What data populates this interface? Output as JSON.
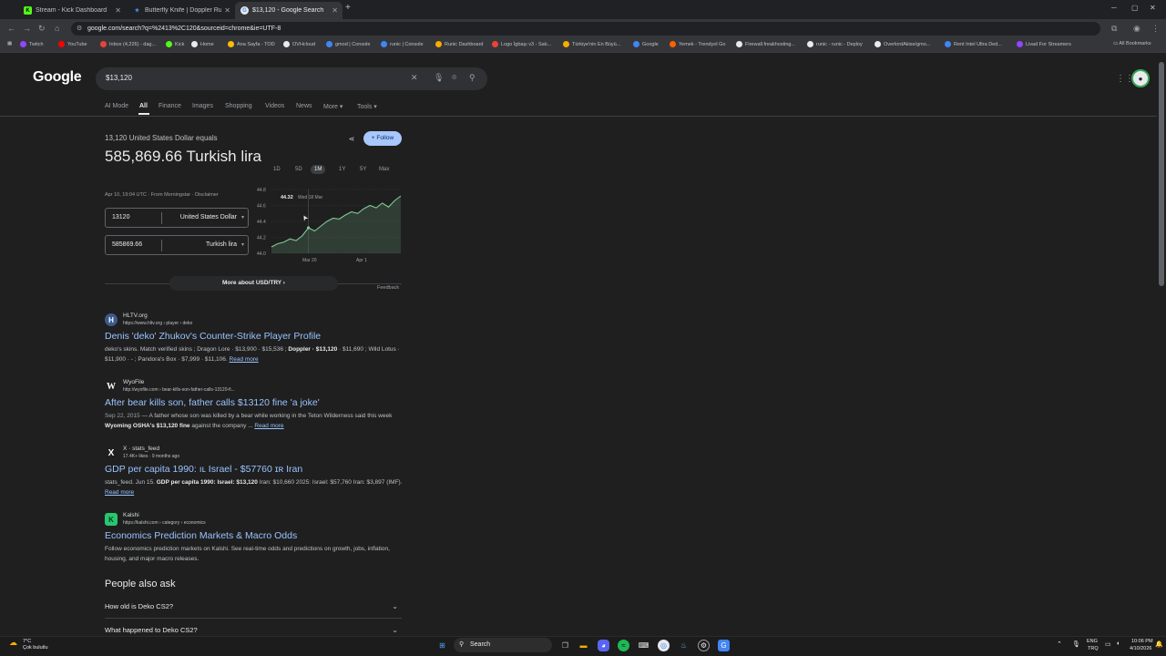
{
  "browser": {
    "tabs": [
      {
        "label": "Stream - Kick Dashboard",
        "fav": "K",
        "fav_color": "#53fc18"
      },
      {
        "label": "Butterfly Knife | Doppler Rub",
        "fav": "★",
        "fav_color": "#4a90e2"
      },
      {
        "label": "$13,120 - Google Search",
        "fav": "G",
        "fav_color": "#4285f4"
      }
    ],
    "new_tab": "+",
    "url": "google.com/search?q=%2413%2C120&sourceid=chrome&ie=UTF-8",
    "bookmarks": [
      "Twitch",
      "YouTube",
      "Inbox (4,226) - dag...",
      "Kick",
      "Home",
      "Ana Sayfa - TOD",
      "OVHcloud",
      "gmod | Console",
      "runic | Console",
      "Runic Dashboard",
      "Logo İgbaşı v3 - Satı...",
      "Türkiye'nin En Büyü...",
      "Google",
      "Yemek - Trendyol Go",
      "Firewall.freakhosting...",
      "runic - runic - Deploy",
      "OverlordAkise/gmo...",
      "Rent Intel Ultra Ded...",
      "Livad For Streamers"
    ],
    "all_bookmarks": "All Bookmarks"
  },
  "google": {
    "logo": "Google",
    "query": "$13,120",
    "tabs": [
      "AI Mode",
      "All",
      "Finance",
      "Images",
      "Shopping",
      "Videos",
      "News",
      "More ▾",
      "Tools ▾"
    ]
  },
  "converter": {
    "subtitle": "13,120 United States Dollar equals",
    "result": "585,869.66 Turkish lira",
    "meta": "Apr 10, 19:04 UTC · From Morningstar · Disclaimer",
    "from_amount": "13120",
    "from_currency": "United States Dollar",
    "to_amount": "585869.66",
    "to_currency": "Turkish lira",
    "follow": "+ Follow",
    "ranges": [
      "1D",
      "5D",
      "1M",
      "1Y",
      "5Y",
      "Max"
    ],
    "active_range": "1M",
    "more_about": "More about USD/TRY  ›",
    "feedback": "Feedback"
  },
  "chart_data": {
    "type": "area",
    "y_ticks": [
      "44.8",
      "44.6",
      "44.4",
      "44.2",
      "44.0"
    ],
    "ylim": [
      44.0,
      44.8
    ],
    "x_ticks": [
      "Mar 20",
      "Apr 1"
    ],
    "tooltip_value": "44.32",
    "tooltip_date": "Wed 18 Mar",
    "values": [
      44.08,
      44.12,
      44.14,
      44.18,
      44.16,
      44.22,
      44.32,
      44.28,
      44.34,
      44.4,
      44.44,
      44.43,
      44.48,
      44.52,
      44.5,
      44.56,
      44.6,
      44.57,
      44.63,
      44.58,
      44.66,
      44.72
    ],
    "line_color": "#81c995"
  },
  "results": [
    {
      "site": "HLTV.org",
      "url": "https://www.hltv.org › player › deko",
      "icon": "H",
      "icon_bg": "#3b5b8c",
      "title": "Denis 'deko' Zhukov's Counter-Strike Player Profile",
      "snippet_parts": [
        "deko's skins. Match verified skins ; Dragon Lore · $13,900 · $15,536 ; ",
        "Doppler · $13,120",
        " · $11,690 ; Wild Lotus · $11,900 · - ; Pandora's Box · $7,999 · $11,106. "
      ],
      "read_more": "Read more"
    },
    {
      "site": "WyoFile",
      "url": "http://wyofile.com › bear-kills-son-father-calls-13120-fi...",
      "icon": "W",
      "icon_bg": "#1f1f1f",
      "title": "After bear kills son, father calls $13120 fine 'a joke'",
      "date": "Sep 22, 2015",
      "snippet_parts": [
        " — A father whose son was killed by a bear while working in the Teton Wilderness said this week ",
        "Wyoming OSHA's $13,120 fine",
        " against the company ... "
      ],
      "read_more": "Read more"
    },
    {
      "site": "X · stats_feed",
      "url": "17.4K+ likes · 9 months ago",
      "icon": "X",
      "icon_bg": "#1f1f1f",
      "title": "GDP per capita 1990: ıʟ Israel - $57760 ɪʀ Iran",
      "snippet_parts": [
        "stats_feed. Jun 15. ",
        "GDP per capita 1990: Israel: $13,120",
        " Iran: $10,660 2025: Israel: $57,760 Iran: $3,897 (IMF). "
      ],
      "read_more": "Read more"
    },
    {
      "site": "Kalshi",
      "url": "https://kalshi.com › category › economics",
      "icon": "K",
      "icon_bg": "#28c76f",
      "title": "Economics Prediction Markets & Macro Odds",
      "snippet_parts": [
        "Follow economics prediction markets on Kalshi. See real-time odds and predictions on growth, jobs, inflation, housing, and major macro releases.",
        "",
        ""
      ],
      "read_more": ""
    }
  ],
  "people_also_ask": {
    "title": "People also ask",
    "questions": [
      "How old is Deko CS2?",
      "What happened to Deko CS2?"
    ]
  },
  "taskbar": {
    "weather_temp": "7°C",
    "weather_desc": "Çok bulutlu",
    "search": "Search",
    "lang": "ENG",
    "region": "TRQ",
    "time": "10:06 PM",
    "date": "4/10/2026"
  }
}
